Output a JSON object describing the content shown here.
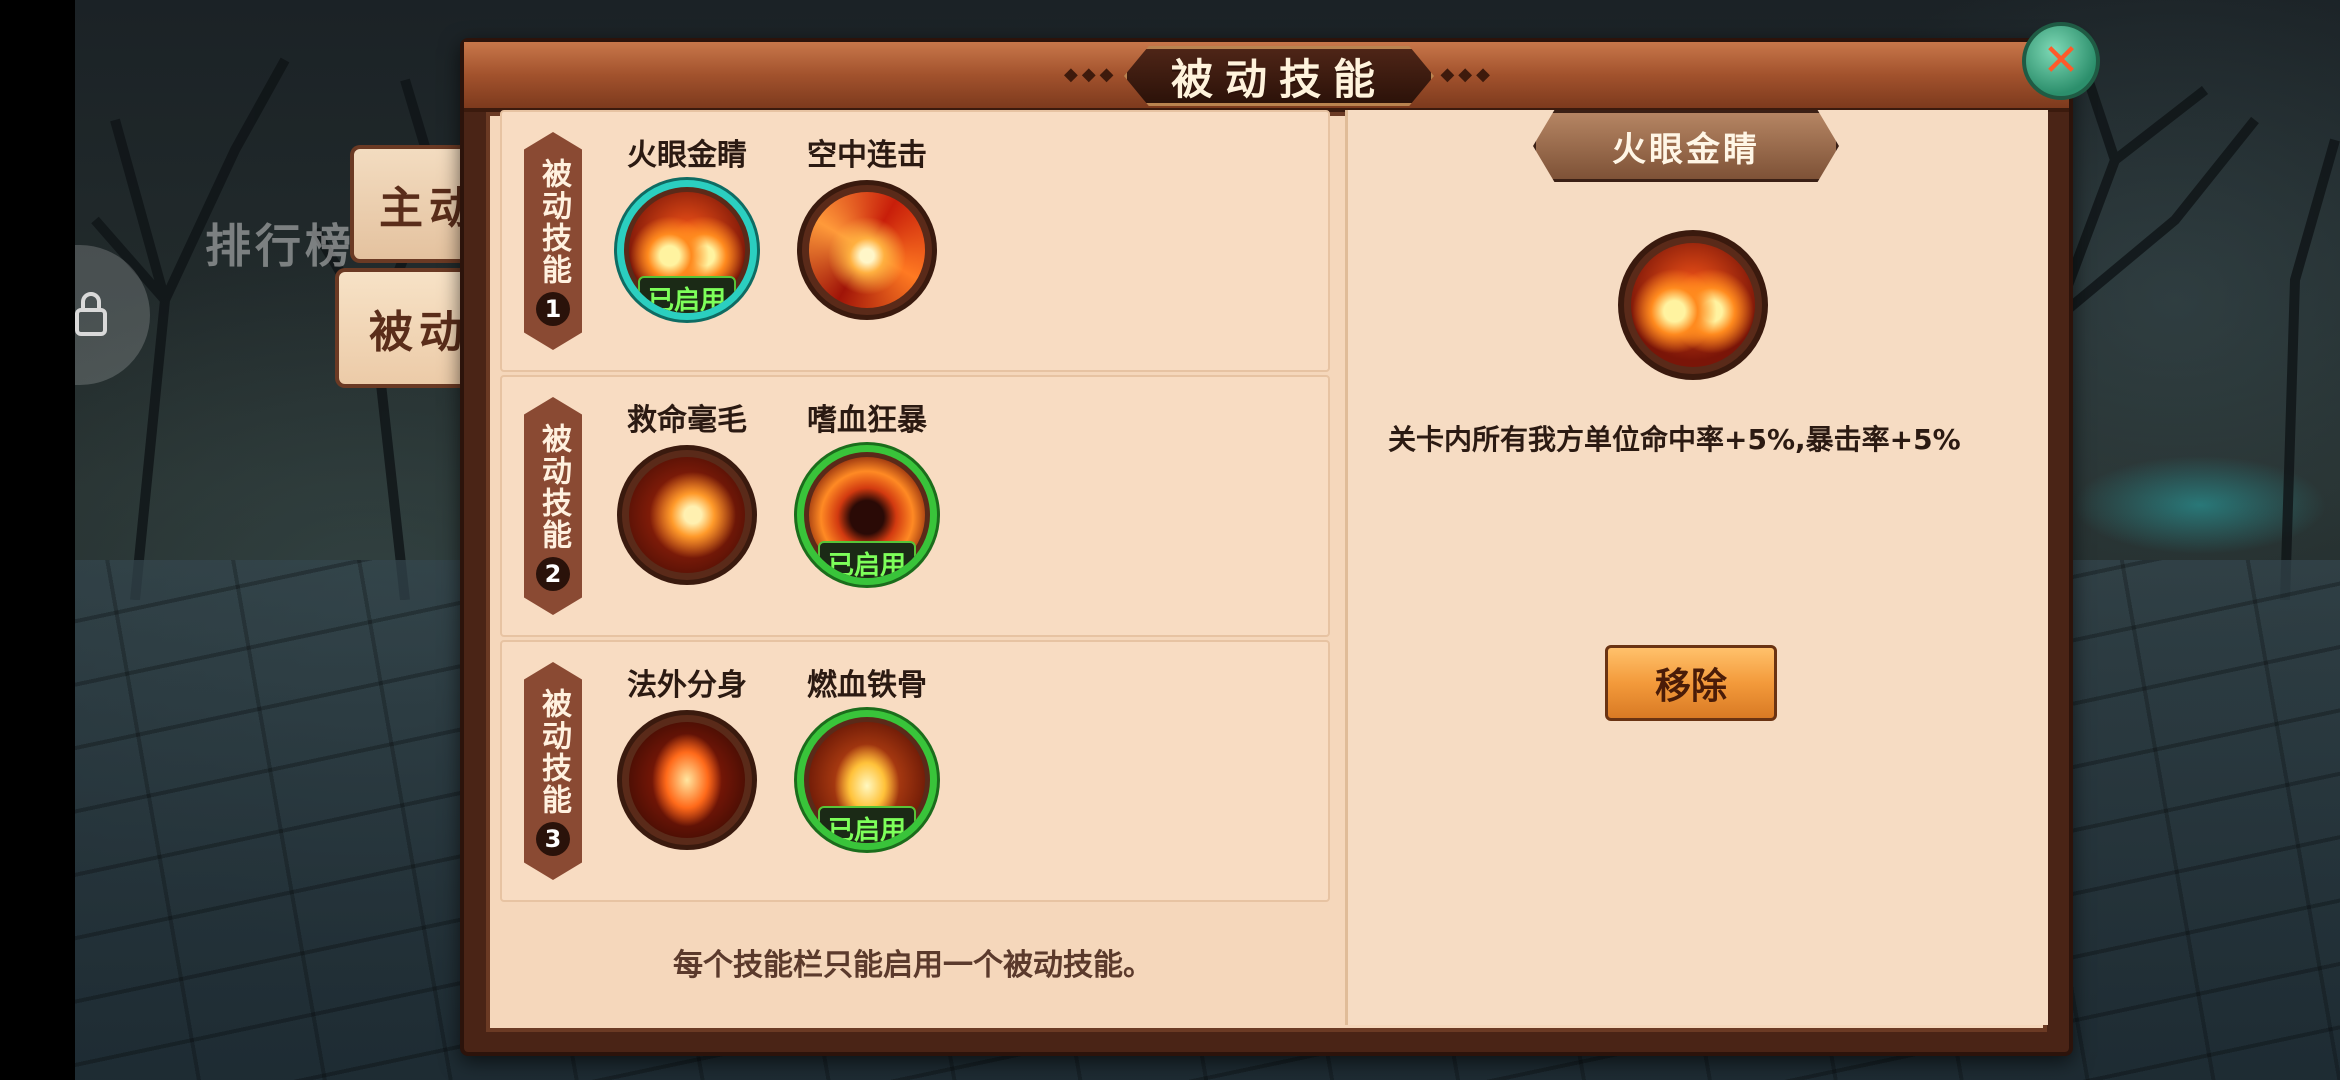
{
  "header": {
    "title": "被动技能",
    "close_icon": "close-icon"
  },
  "side_tabs": [
    {
      "label": "主动",
      "has_red_dot": true
    },
    {
      "label": "被动",
      "active": true
    }
  ],
  "background": {
    "faded_title": "排行榜"
  },
  "slots": [
    {
      "label": "被动技能",
      "number": "1",
      "skills": [
        {
          "name": "火眼金睛",
          "icon": "fire-eyes-icon",
          "enabled": true,
          "ring": "teal"
        },
        {
          "name": "空中连击",
          "icon": "air-combo-icon",
          "enabled": false
        }
      ]
    },
    {
      "label": "被动技能",
      "number": "2",
      "skills": [
        {
          "name": "救命毫毛",
          "icon": "life-hair-icon",
          "enabled": false
        },
        {
          "name": "嗜血狂暴",
          "icon": "bloodlust-icon",
          "enabled": true,
          "ring": "green"
        }
      ]
    },
    {
      "label": "被动技能",
      "number": "3",
      "skills": [
        {
          "name": "法外分身",
          "icon": "clone-icon",
          "enabled": false
        },
        {
          "name": "燃血铁骨",
          "icon": "iron-bone-icon",
          "enabled": true,
          "ring": "green"
        }
      ]
    }
  ],
  "enabled_label": "已启用",
  "tip": "每个技能栏只能启用一个被动技能。",
  "detail": {
    "name": "火眼金睛",
    "icon": "fire-eyes-icon",
    "description": "关卡内所有我方单位命中率+5%,暴击率+5%",
    "remove_label": "移除"
  },
  "colors": {
    "panel_bg": "#f5d7bb",
    "enabled_text": "#7dff5a",
    "selected_ring_teal": "#2bcfc0",
    "selected_ring_green": "#39c43a",
    "button_orange": "#f39a3b"
  }
}
